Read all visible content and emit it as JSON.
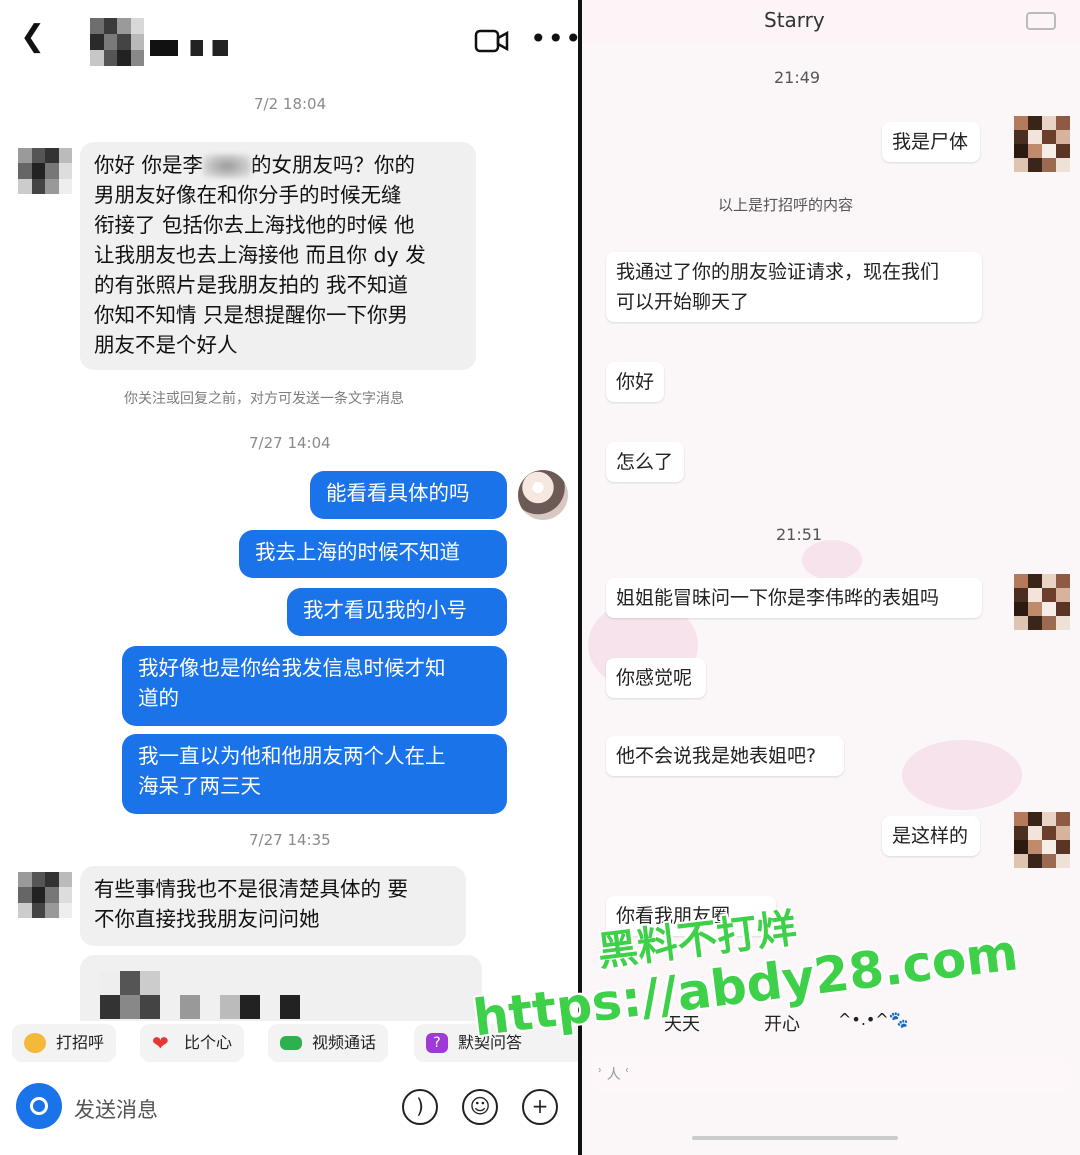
{
  "left_chat": {
    "timestamps": [
      "7/2 18:04",
      "7/27 14:04",
      "7/27 14:35"
    ],
    "msg_in_1": [
      "你好 你是李",
      "的女朋友吗？你的",
      "男朋友好像在和你分手的时候无缝",
      "衔接了 包括你去上海找他的时候 他",
      "让我朋友也去上海接他 而且你 dy 发",
      "的有张照片是我朋友拍的 我不知道",
      "你知不知情 只是想提醒你一下你男",
      "朋友不是个好人"
    ],
    "notice": "你关注或回复之前，对方可发送一条文字消息",
    "msgs_out": [
      [
        "能看看具体的吗"
      ],
      [
        "我去上海的时候不知道"
      ],
      [
        "我才看见我的小号"
      ],
      [
        "我好像也是你给我发信息时候才知",
        "道的"
      ],
      [
        "我一直以为他和他朋友两个人在上",
        "海呆了两三天"
      ]
    ],
    "msg_in_2": [
      "有些事情我也不是很清楚具体的 要",
      "不你直接找我朋友问问她"
    ],
    "chips": [
      "打招呼",
      "比个心",
      "视频通话",
      "默契问答"
    ],
    "input_placeholder": "发送消息"
  },
  "right_chat": {
    "title": "Starry",
    "times": [
      "21:49",
      "21:51"
    ],
    "msg_me_1": "我是尸体",
    "hint": "以上是打招呼的内容",
    "msg_verify": [
      "我通过了你的朋友验证请求，现在我们",
      "可以开始聊天了"
    ],
    "msg_hello": "你好",
    "msg_what": "怎么了",
    "msg_ask": "姐姐能冒昧问一下你是李伟晔的表姐吗",
    "msg_feel": "你感觉呢",
    "msg_cousin": "他不会说我是她表姐吧?",
    "msg_yes": "是这样的",
    "msg_partial": "你看我朋友圈",
    "quick": [
      "天天",
      "开心"
    ],
    "kaomoji": "^•.•^🐾",
    "input_hint": "ʾ 人 ʿ"
  },
  "watermark": {
    "line1": "黑料不打烊",
    "line2": "https://abdy28.com"
  },
  "colors": {
    "blue_bubble": "#1a73e8",
    "watermark_green": "#3fd04a",
    "right_bg": "#fbf6f8"
  },
  "icons": [
    "back-icon",
    "video-call-icon",
    "more-icon",
    "camera-icon",
    "voice-icon",
    "emoji-icon",
    "plus-icon"
  ]
}
